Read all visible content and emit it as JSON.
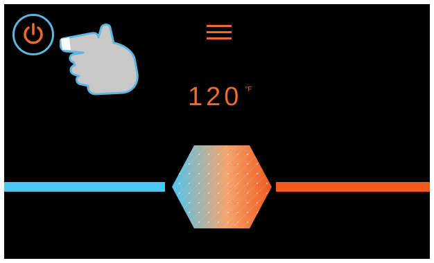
{
  "temperature": {
    "value": "120",
    "unit": "°F"
  },
  "icons": {
    "power": "power-icon",
    "menu": "hamburger-menu-icon",
    "hand": "pointing-hand-icon",
    "slider": "hexagon-temperature-thumb"
  },
  "colors": {
    "background": "#000000",
    "accent_orange": "#f06a2d",
    "cold_blue": "#4cc5ef",
    "hot_orange": "#f0591f",
    "highlight_ring": "#5cb8e3",
    "hand_fill": "#c8c8c8"
  }
}
